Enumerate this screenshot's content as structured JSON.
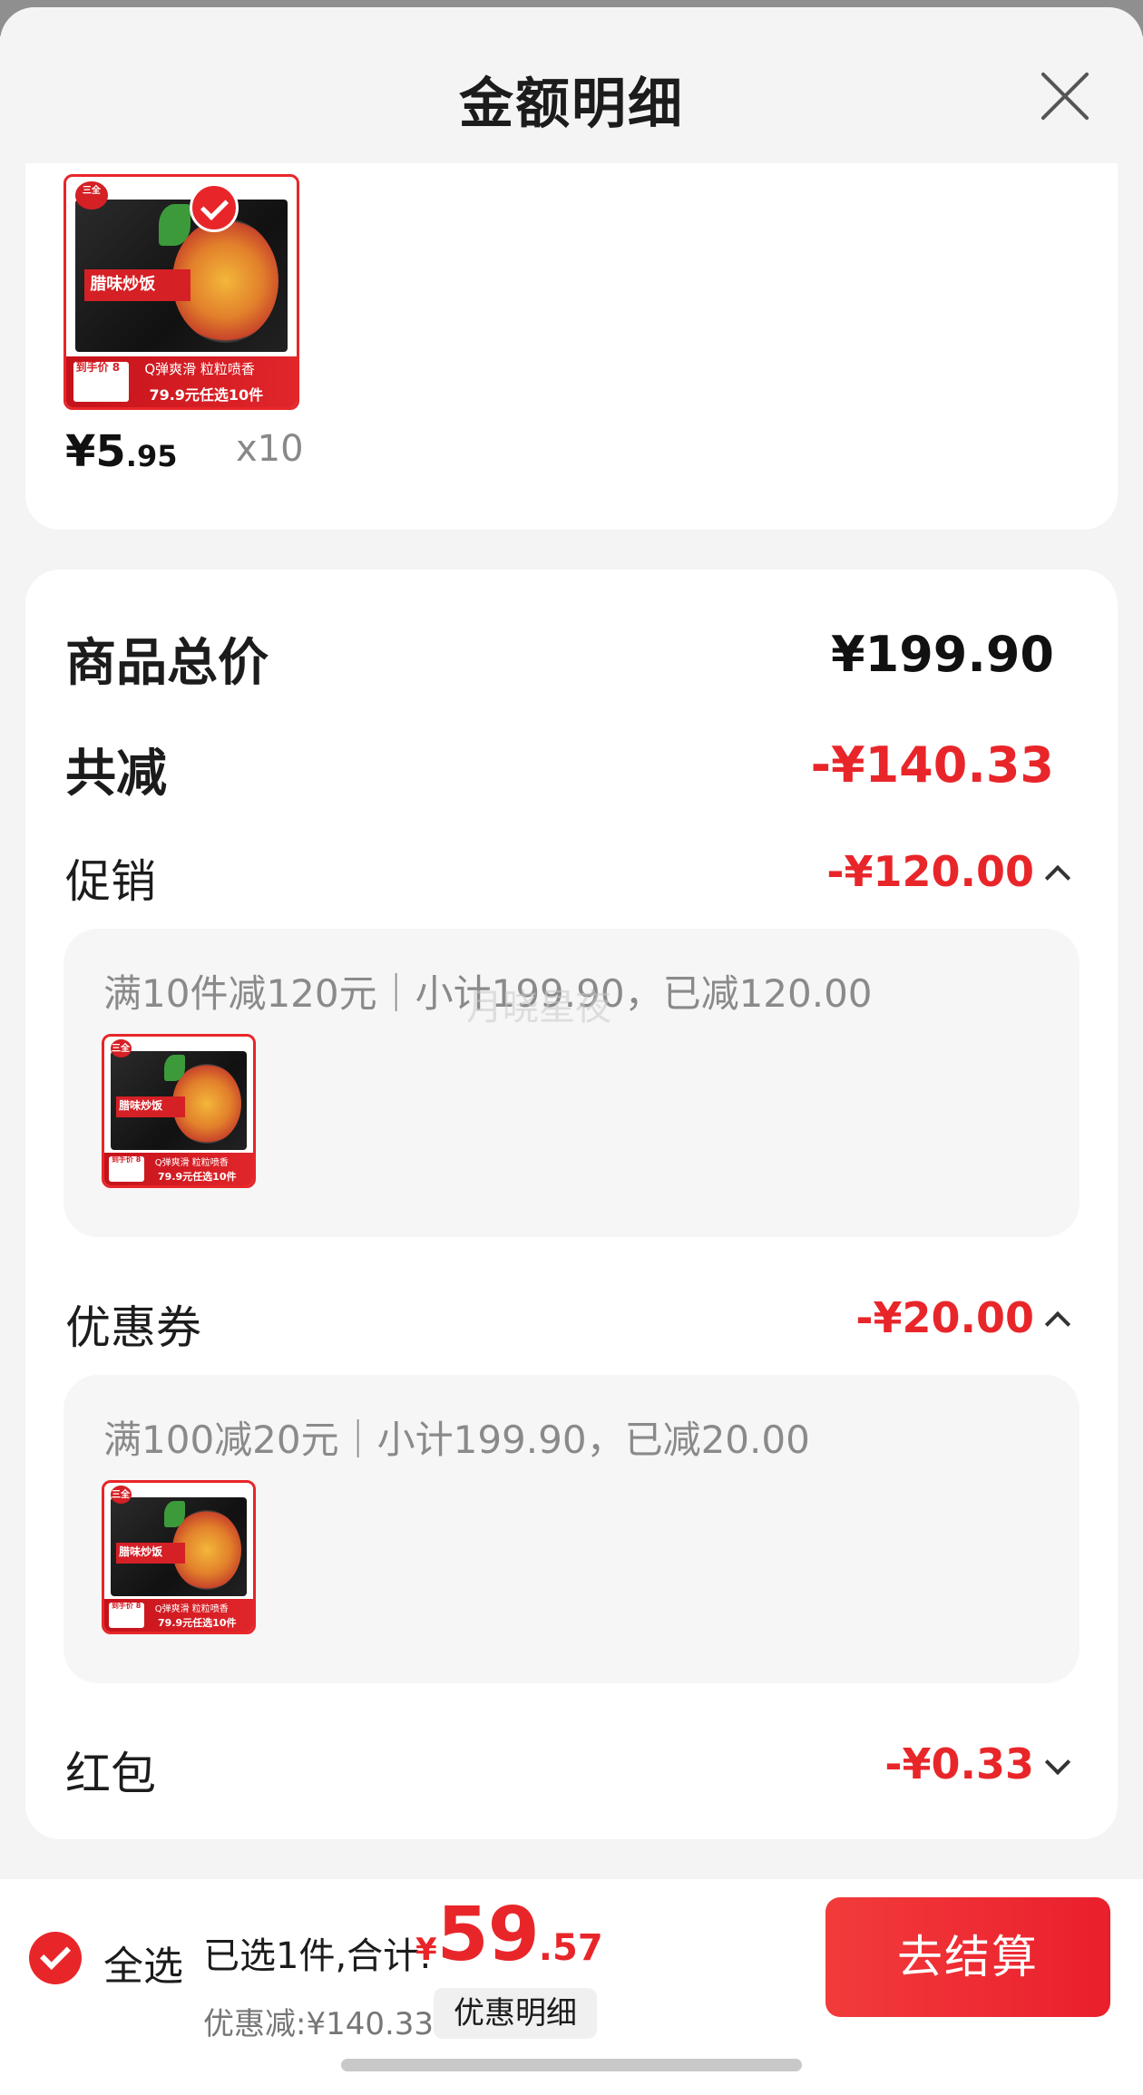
{
  "sheet": {
    "title": "金额明细",
    "close_icon": "close-icon"
  },
  "product": {
    "name": "腊味炒饭",
    "badge_selected": true,
    "ribbon_tag": "Q弹爽滑 粒粒喷香",
    "ribbon_promo": "79.9元任选10件",
    "ribbon_price_tag": "到手价 8",
    "price_int": "¥5",
    "price_dec": ".95",
    "quantity": "x10"
  },
  "summary": {
    "total_label": "商品总价",
    "total_value": "¥199.90",
    "reduce_label": "共减",
    "reduce_value": "-¥140.33",
    "promo_label": "促销",
    "promo_value": "-¥120.00",
    "promo_desc": "满10件减120元｜小计199.90，已减120.00",
    "coupon_label": "优惠券",
    "coupon_value": "-¥20.00",
    "coupon_desc": "满100减20元｜小计199.90，已减20.00",
    "redpacket_label": "红包",
    "redpacket_value": "-¥0.33"
  },
  "watermark": "月晓星夜",
  "bottom_bar": {
    "select_all_label": "全选",
    "selected_text": "已选1件,合计:",
    "currency": "¥",
    "total_int": "59",
    "total_dec": ".57",
    "discount_text": "优惠减:¥140.33",
    "detail_button": "优惠明细",
    "checkout_button": "去结算"
  },
  "colors": {
    "accent_red": "#e8262a",
    "background": "#f4f4f4",
    "card": "#ffffff"
  }
}
